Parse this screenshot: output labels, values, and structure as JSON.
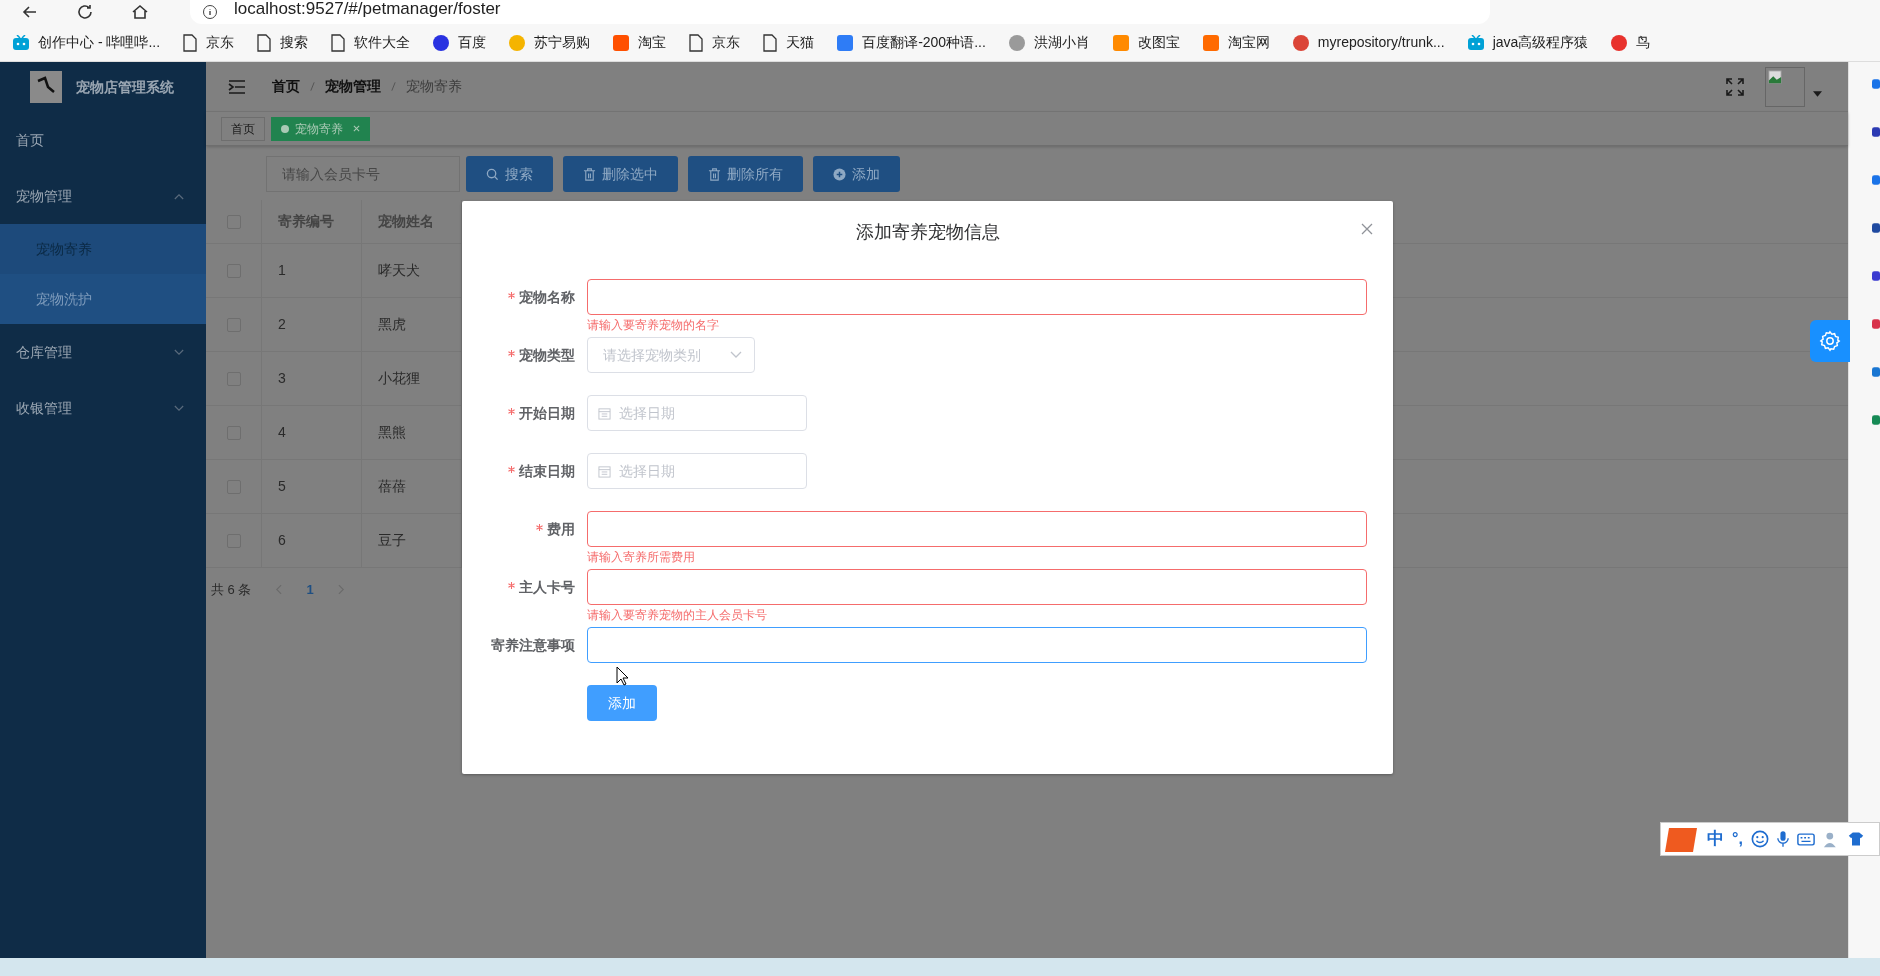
{
  "browser": {
    "address": "localhost:9527/#/petmanager/foster",
    "bookmarks": [
      {
        "label": "创作中心 - 哔哩哔...",
        "kind": "tv",
        "color": "#00a1d6"
      },
      {
        "label": "京东",
        "kind": "page"
      },
      {
        "label": "搜索",
        "kind": "page"
      },
      {
        "label": "软件大全",
        "kind": "page"
      },
      {
        "label": "百度",
        "kind": "dot",
        "color": "#2932e1"
      },
      {
        "label": "苏宁易购",
        "kind": "dot",
        "color": "#f5b400"
      },
      {
        "label": "淘宝",
        "kind": "square",
        "color": "#ff5000"
      },
      {
        "label": "京东",
        "kind": "page"
      },
      {
        "label": "天猫",
        "kind": "page"
      },
      {
        "label": "百度翻译-200种语...",
        "kind": "square",
        "color": "#2e7cf6"
      },
      {
        "label": "洪湖小肖",
        "kind": "dot",
        "color": "#9a9a9a"
      },
      {
        "label": "改图宝",
        "kind": "square",
        "color": "#ff8a00"
      },
      {
        "label": "淘宝网",
        "kind": "square",
        "color": "#ff6a00"
      },
      {
        "label": "myrepository/trunk...",
        "kind": "dot",
        "color": "#db4437"
      },
      {
        "label": "java高级程序猿",
        "kind": "tv",
        "color": "#00a1d6"
      },
      {
        "label": "鸟",
        "kind": "dot",
        "color": "#e8322d"
      }
    ]
  },
  "app": {
    "title": "宠物店管理系统",
    "menu": [
      {
        "label": "首页",
        "kind": "link",
        "selected": false
      },
      {
        "label": "宠物管理",
        "kind": "group",
        "expanded": true,
        "selected": false,
        "children": [
          {
            "label": "宠物寄养",
            "selected": true
          },
          {
            "label": "宠物洗护",
            "selected": false
          }
        ]
      },
      {
        "label": "仓库管理",
        "kind": "group",
        "expanded": false,
        "selected": false
      },
      {
        "label": "收银管理",
        "kind": "group",
        "expanded": false,
        "selected": false
      }
    ],
    "breadcrumb": [
      "首页",
      "宠物管理",
      "宠物寄养"
    ],
    "tags": [
      {
        "label": "首页",
        "selected": false
      },
      {
        "label": "宠物寄养",
        "selected": true
      }
    ],
    "toolbar": {
      "search_placeholder": "请输入会员卡号",
      "buttons": [
        {
          "label": "搜索",
          "kind": "search"
        },
        {
          "label": "删除选中",
          "kind": "trash"
        },
        {
          "label": "删除所有",
          "kind": "trash"
        },
        {
          "label": "添加",
          "kind": "plus"
        }
      ]
    },
    "table": {
      "all_checked": false,
      "columns": [
        "寄养编号",
        "宠物姓名"
      ],
      "rows": [
        {
          "cells": [
            "1",
            "哮天犬"
          ],
          "checked": false
        },
        {
          "cells": [
            "2",
            "黑虎"
          ],
          "checked": false
        },
        {
          "cells": [
            "3",
            "小花狸"
          ],
          "checked": false
        },
        {
          "cells": [
            "4",
            "黑熊"
          ],
          "checked": false
        },
        {
          "cells": [
            "5",
            "蓓蓓"
          ],
          "checked": false
        },
        {
          "cells": [
            "6",
            "豆子"
          ],
          "checked": false
        }
      ]
    },
    "pagination": {
      "total": "共 6 条",
      "pages": [
        {
          "label": "1",
          "selected": true
        }
      ]
    }
  },
  "dialog": {
    "title": "添加寄养宠物信息",
    "fields": [
      {
        "label": "宠物名称",
        "required": true,
        "kind": "input",
        "error": "请输入要寄养宠物的名字",
        "focused": false
      },
      {
        "label": "宠物类型",
        "required": true,
        "kind": "select",
        "placeholder": "请选择宠物类别",
        "focused": false
      },
      {
        "label": "开始日期",
        "required": true,
        "kind": "date",
        "placeholder": "选择日期",
        "focused": false
      },
      {
        "label": "结束日期",
        "required": true,
        "kind": "date",
        "placeholder": "选择日期",
        "focused": false
      },
      {
        "label": "费用",
        "required": true,
        "kind": "input",
        "error": "请输入寄养所需费用",
        "focused": false
      },
      {
        "label": "主人卡号",
        "required": true,
        "kind": "input",
        "error": "请输入要寄养宠物的主人会员卡号",
        "focused": false
      },
      {
        "label": "寄养注意事项",
        "required": false,
        "kind": "input",
        "focused": true
      }
    ],
    "submit": "添加"
  },
  "ime": {
    "mode": "中",
    "punctuation": "°,"
  }
}
